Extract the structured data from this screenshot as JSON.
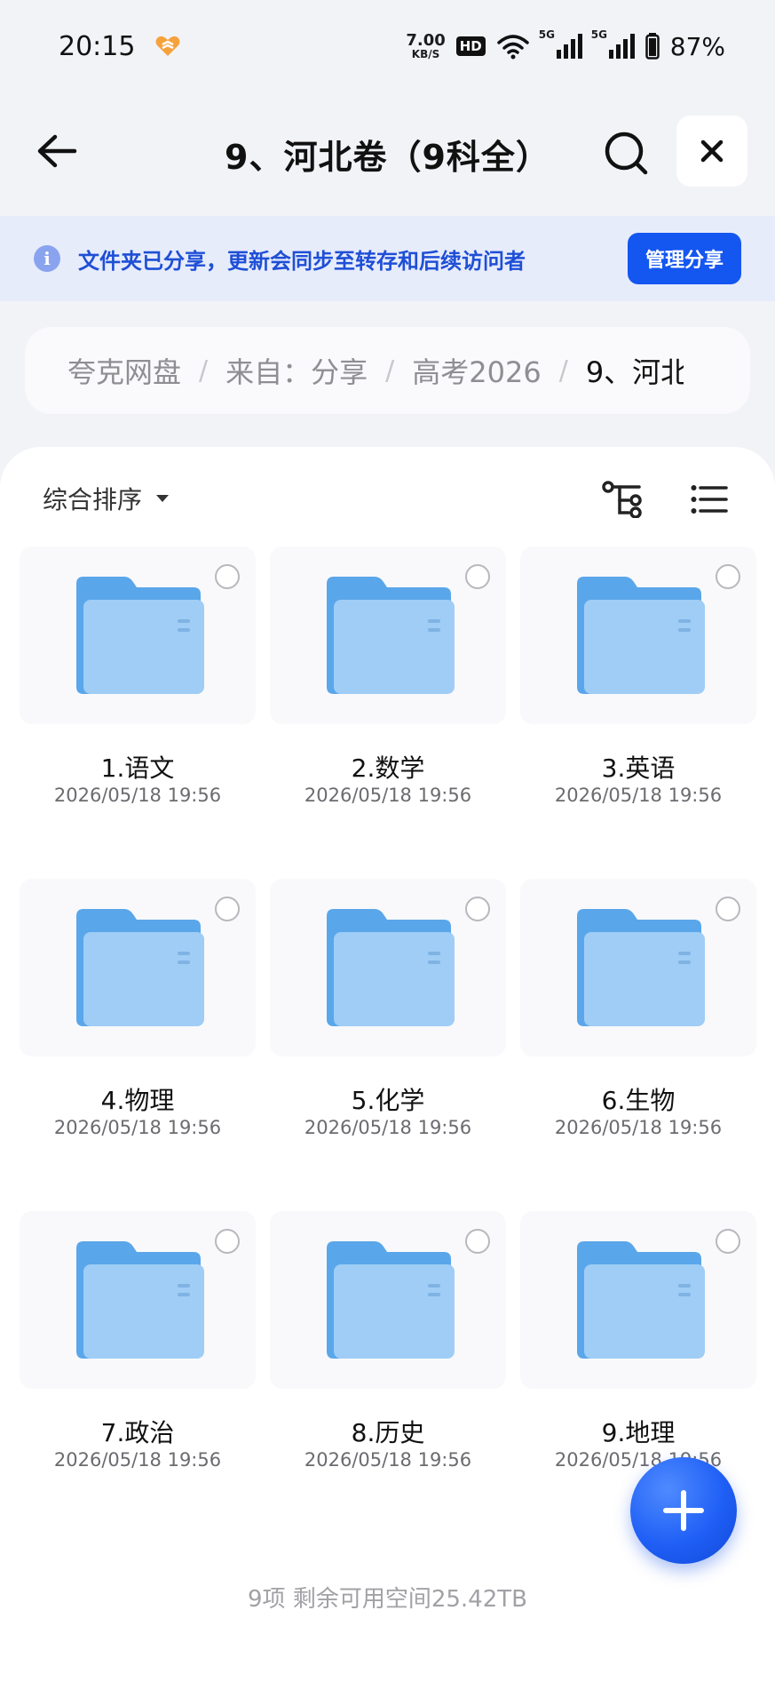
{
  "status_bar": {
    "time": "20:15",
    "net_speed_value": "7.00",
    "net_speed_unit": "KB/S",
    "hd_label": "HD",
    "signal1_label": "5G",
    "signal2_label": "5G",
    "battery_percent": "87%"
  },
  "header": {
    "title": "9、河北卷（9科全）",
    "back_icon": "arrow-left-icon",
    "search_icon": "search-icon",
    "close_icon": "close-icon"
  },
  "banner": {
    "text": "文件夹已分享，更新会同步至转存和后续访问者",
    "button_label": "管理分享"
  },
  "breadcrumb": {
    "items": [
      "夸克网盘",
      "来自：分享",
      "高考2026",
      "9、河北"
    ]
  },
  "toolbar": {
    "sort_label": "综合排序"
  },
  "folders": [
    {
      "name": "1.语文",
      "date": "2026/05/18 19:56"
    },
    {
      "name": "2.数学",
      "date": "2026/05/18 19:56"
    },
    {
      "name": "3.英语",
      "date": "2026/05/18 19:56"
    },
    {
      "name": "4.物理",
      "date": "2026/05/18 19:56"
    },
    {
      "name": "5.化学",
      "date": "2026/05/18 19:56"
    },
    {
      "name": "6.生物",
      "date": "2026/05/18 19:56"
    },
    {
      "name": "7.政治",
      "date": "2026/05/18 19:56"
    },
    {
      "name": "8.历史",
      "date": "2026/05/18 19:56"
    },
    {
      "name": "9.地理",
      "date": "2026/05/18 19:56"
    }
  ],
  "footer": {
    "summary": "9项 剩余可用空间25.42TB"
  },
  "colors": {
    "accent": "#1456f0",
    "banner_bg": "#e7ecfb",
    "folder": "#7fbaf0"
  }
}
